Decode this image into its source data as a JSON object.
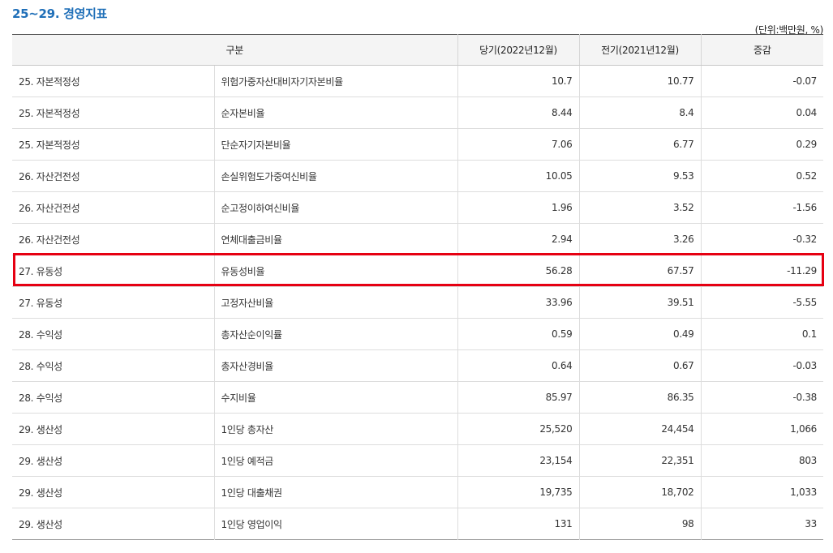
{
  "title": "25~29. 경영지표",
  "unit": "(단위:백만원, %)",
  "headers": {
    "category": "구분",
    "current": "당기(2022년12월)",
    "previous": "전기(2021년12월)",
    "change": "증감"
  },
  "highlight_color": "#e60012",
  "rows": [
    {
      "group": "25. 자본적정성",
      "item": "위험가중자산대비자기자본비율",
      "current": "10.7",
      "previous": "10.77",
      "change": "-0.07"
    },
    {
      "group": "25. 자본적정성",
      "item": "순자본비율",
      "current": "8.44",
      "previous": "8.4",
      "change": "0.04"
    },
    {
      "group": "25. 자본적정성",
      "item": "단순자기자본비율",
      "current": "7.06",
      "previous": "6.77",
      "change": "0.29"
    },
    {
      "group": "26. 자산건전성",
      "item": "손실위험도가중여신비율",
      "current": "10.05",
      "previous": "9.53",
      "change": "0.52"
    },
    {
      "group": "26. 자산건전성",
      "item": "순고정이하여신비율",
      "current": "1.96",
      "previous": "3.52",
      "change": "-1.56"
    },
    {
      "group": "26. 자산건전성",
      "item": "연체대출금비율",
      "current": "2.94",
      "previous": "3.26",
      "change": "-0.32"
    },
    {
      "group": "27. 유동성",
      "item": "유동성비율",
      "current": "56.28",
      "previous": "67.57",
      "change": "-11.29"
    },
    {
      "group": "27. 유동성",
      "item": "고정자산비율",
      "current": "33.96",
      "previous": "39.51",
      "change": "-5.55"
    },
    {
      "group": "28. 수익성",
      "item": "총자산순이익률",
      "current": "0.59",
      "previous": "0.49",
      "change": "0.1"
    },
    {
      "group": "28. 수익성",
      "item": "총자산경비율",
      "current": "0.64",
      "previous": "0.67",
      "change": "-0.03"
    },
    {
      "group": "28. 수익성",
      "item": "수지비율",
      "current": "85.97",
      "previous": "86.35",
      "change": "-0.38"
    },
    {
      "group": "29. 생산성",
      "item": "1인당 총자산",
      "current": "25,520",
      "previous": "24,454",
      "change": "1,066"
    },
    {
      "group": "29. 생산성",
      "item": "1인당 예적금",
      "current": "23,154",
      "previous": "22,351",
      "change": "803"
    },
    {
      "group": "29. 생산성",
      "item": "1인당 대출채권",
      "current": "19,735",
      "previous": "18,702",
      "change": "1,033"
    },
    {
      "group": "29. 생산성",
      "item": "1인당 영업이익",
      "current": "131",
      "previous": "98",
      "change": "33"
    }
  ]
}
